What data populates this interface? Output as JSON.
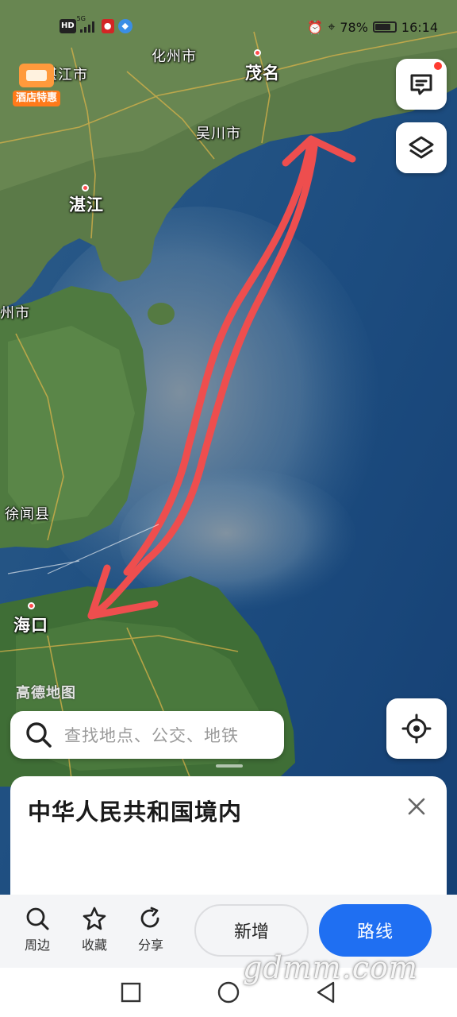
{
  "status_bar": {
    "network_hd": "HD",
    "network_type": "5G",
    "battery": "78%",
    "battery_level": 0.78,
    "time": "16:14"
  },
  "map": {
    "labels": {
      "zhanjiang_city_partial": "湛江市",
      "huazhou": "化州市",
      "maoming": "茂名",
      "wuchuan": "吴川市",
      "zhanjiang": "湛江",
      "leizhou_partial": "州市",
      "xuwen": "徐闻县",
      "haikou": "海口"
    },
    "watermark": "高德地图",
    "route_color": "#ee4e4e"
  },
  "hotel_badge": {
    "label": "酒店特惠"
  },
  "float_buttons": {
    "feedback_icon": "message-icon",
    "layers_icon": "layers-icon",
    "locate_icon": "locate-icon"
  },
  "search": {
    "placeholder": "查找地点、公交、地铁"
  },
  "place_card": {
    "title": "中华人民共和国境内"
  },
  "actions": {
    "nearby": "周边",
    "favorite": "收藏",
    "share": "分享",
    "add": "新增",
    "route": "路线"
  },
  "site_watermark": "gdmm.com",
  "colors": {
    "accent": "#1f6ff2",
    "badge": "#ff7a1a",
    "alert": "#ff3b30"
  }
}
